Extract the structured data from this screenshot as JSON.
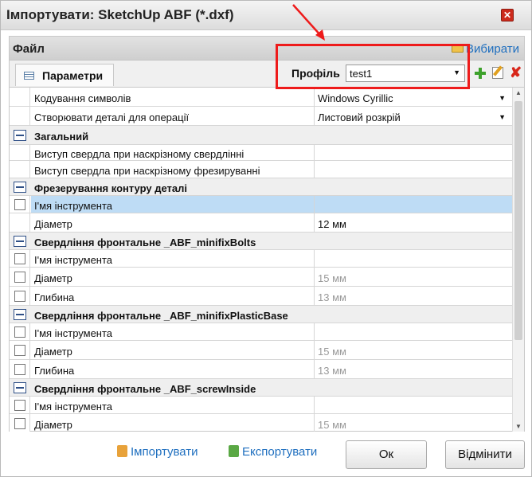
{
  "window": {
    "title": "Імпортувати: SketchUp ABF (*.dxf)",
    "close_glyph": "✕"
  },
  "panel": {
    "title": "Файл",
    "choose_label": "Вибирати"
  },
  "tab": {
    "label": "Параметри"
  },
  "profile": {
    "label": "Профіль",
    "value": "test1"
  },
  "rows": [
    {
      "type": "prop",
      "name": "Кодування символів",
      "value": "Windows Cyrillic",
      "dropdown": true
    },
    {
      "type": "prop",
      "name": "Створювати деталі для операції",
      "value": "Листовий розкрій",
      "dropdown": true
    },
    {
      "type": "group",
      "name": "Загальний"
    },
    {
      "type": "prop",
      "name": "Виступ свердла при наскрізному свердлінні",
      "value": ""
    },
    {
      "type": "prop",
      "name": "Виступ свердла при наскрізному фрезируванні",
      "value": ""
    },
    {
      "type": "group",
      "name": "Фрезерування контуру деталі"
    },
    {
      "type": "check",
      "name": "І'мя інструмента",
      "value": "",
      "selected": true
    },
    {
      "type": "prop",
      "name": "Діаметр",
      "value": "12 мм"
    },
    {
      "type": "group",
      "name": "Свердління фронтальне _ABF_minifixBolts"
    },
    {
      "type": "check",
      "name": "І'мя інструмента",
      "value": ""
    },
    {
      "type": "check",
      "name": "Діаметр",
      "value": "15 мм",
      "muted": true
    },
    {
      "type": "check",
      "name": "Глибина",
      "value": "13 мм",
      "muted": true
    },
    {
      "type": "group",
      "name": "Свердління фронтальне _ABF_minifixPlasticBase"
    },
    {
      "type": "check",
      "name": "І'мя інструмента",
      "value": ""
    },
    {
      "type": "check",
      "name": "Діаметр",
      "value": "15 мм",
      "muted": true
    },
    {
      "type": "check",
      "name": "Глибина",
      "value": "13 мм",
      "muted": true
    },
    {
      "type": "group",
      "name": "Свердління фронтальне _ABF_screwInside"
    },
    {
      "type": "check",
      "name": "І'мя інструмента",
      "value": ""
    },
    {
      "type": "check",
      "name": "Діаметр",
      "value": "15 мм",
      "muted": true
    }
  ],
  "footer": {
    "import_label": "Імпортувати",
    "export_label": "Експортувати",
    "ok_label": "Ок",
    "cancel_label": "Відмінити"
  },
  "icons": {
    "close": "close-icon",
    "choose": "folder-icon",
    "tab": "grid-icon",
    "add": "plus-icon",
    "edit": "edit-icon",
    "delete": "delete-icon",
    "group": "collapse-icon",
    "import": "import-icon",
    "export": "export-icon"
  },
  "colors": {
    "accent_link": "#1f6fbf",
    "selection": "#bedcf5",
    "annotation_red": "#ee1b1b",
    "close_red": "#cc2a1c",
    "add_green": "#3da12b"
  }
}
